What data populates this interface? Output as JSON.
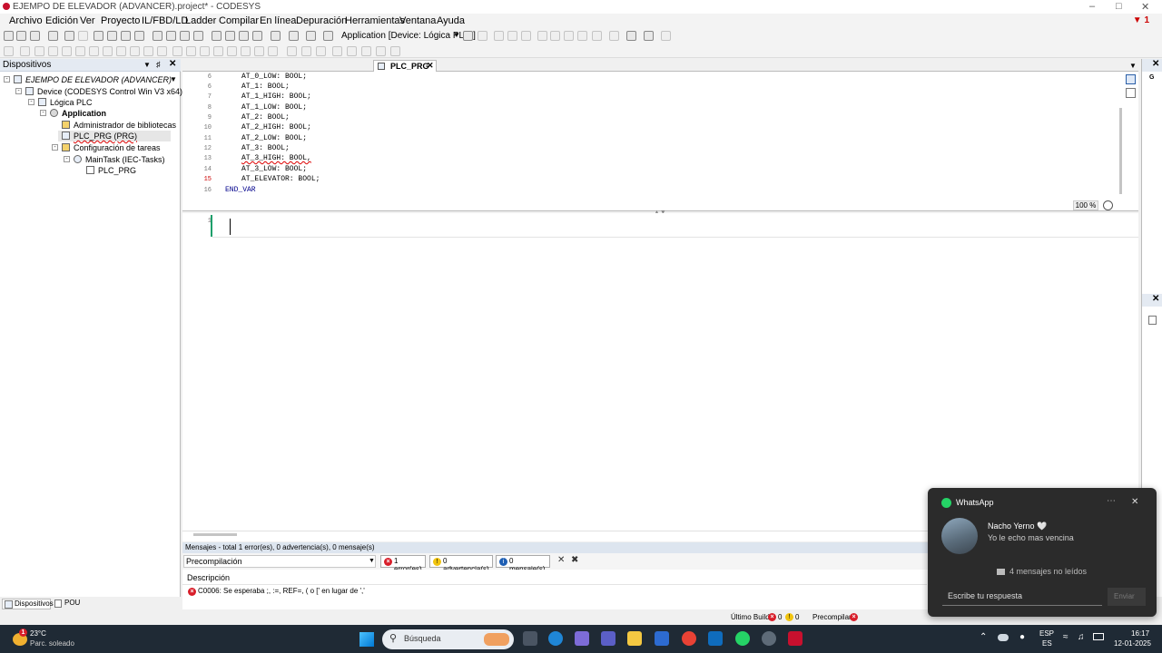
{
  "window": {
    "title": "EJEMPO DE ELEVADOR (ADVANCER).project* - CODESYS",
    "alert_count": "1"
  },
  "menu": [
    "Archivo",
    "Edición",
    "Ver",
    "Proyecto",
    "IL/FBD/LD",
    "Ladder",
    "Compilar",
    "En línea",
    "Depuración",
    "Herramientas",
    "Ventana",
    "Ayuda"
  ],
  "toolbar": {
    "active_app": "Application [Device: Lógica PLC ]"
  },
  "devices": {
    "panel_title": "Dispositivos",
    "tree": [
      {
        "label": "EJEMPO DE ELEVADOR (ADVANCER)"
      },
      {
        "label": "Device (CODESYS Control Win V3 x64)"
      },
      {
        "label": "Lógica PLC"
      },
      {
        "label": "Application"
      },
      {
        "label": "Administrador de bibliotecas"
      },
      {
        "label": "PLC_PRG (PRG)"
      },
      {
        "label": "Configuración de tareas"
      },
      {
        "label": "MainTask (IEC-Tasks)"
      },
      {
        "label": "PLC_PRG"
      }
    ],
    "bottom_tabs": [
      "Dispositivos",
      "POU"
    ]
  },
  "editor": {
    "tab_label": "PLC_PRG",
    "lines": [
      {
        "n": "6",
        "t": "AT_0_LOW: BOOL;"
      },
      {
        "n": "6",
        "t": "AT_1: BOOL;"
      },
      {
        "n": "7",
        "t": "AT_1_HIGH: BOOL;"
      },
      {
        "n": "8",
        "t": "AT_1_LOW: BOOL;"
      },
      {
        "n": "9",
        "t": "AT_2: BOOL;"
      },
      {
        "n": "10",
        "t": "AT_2_HIGH: BOOL;"
      },
      {
        "n": "11",
        "t": "AT_2_LOW: BOOL;"
      },
      {
        "n": "12",
        "t": "AT_3: BOOL;"
      },
      {
        "n": "13",
        "t": "AT_3_HIGH: BOOL,"
      },
      {
        "n": "14",
        "t": "AT_3_LOW: BOOL;"
      },
      {
        "n": "15",
        "t": "AT_ELEVATOR: BOOL;"
      },
      {
        "n": "16",
        "t": "END_VAR"
      }
    ],
    "zoom": "100 %",
    "body_line": "1"
  },
  "messages": {
    "header": "Mensajes - total 1 error(es), 0 advertencia(s), 0 mensaje(s)",
    "filter": "Precompilación",
    "errors": "1 error(es)",
    "warnings": "0 advertencia(s)",
    "msgs": "0 mensaje(s)",
    "col_desc": "Descripción",
    "error_text": "C0006:  Se esperaba ;, :=, REF=, ( o [' en lugar de ','"
  },
  "statusbar": {
    "last_build": "Último Build",
    "err_count": "0",
    "warn_count": "0",
    "precompile": "Precompilar"
  },
  "toast": {
    "app": "WhatsApp",
    "sender": "Nacho Yerno 🤍",
    "message": "Yo le echo mas vencina",
    "unread": "4 mensajes no leídos",
    "reply_placeholder": "Escribe tu respuesta",
    "send": "Enviar"
  },
  "taskbar": {
    "temp": "23°C",
    "weather": "Parc. soleado",
    "search": "Búsqueda",
    "lang1": "ESP",
    "lang2": "ES",
    "time": "16:17",
    "date": "12-01-2025",
    "weather_badge": "1"
  },
  "colors": {
    "accent": "#c8102e",
    "error_red": "#d81e2a",
    "taskbar": "#1f2a35",
    "toast_bg": "#2b2b2b"
  }
}
